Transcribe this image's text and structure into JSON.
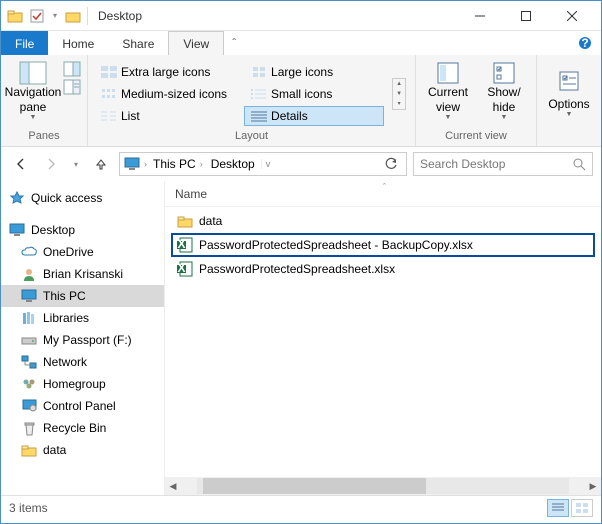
{
  "window": {
    "title": "Desktop"
  },
  "tabs": {
    "file": "File",
    "home": "Home",
    "share": "Share",
    "view": "View"
  },
  "ribbon": {
    "panes": {
      "label": "Panes",
      "nav_pane": "Navigation\npane"
    },
    "layout": {
      "label": "Layout",
      "items": [
        "Extra large icons",
        "Large icons",
        "Medium-sized icons",
        "Small icons",
        "List",
        "Details"
      ]
    },
    "current_view": {
      "label": "Current view",
      "current": "Current\nview",
      "showhide": "Show/\nhide"
    },
    "options": {
      "label": "",
      "options": "Options"
    }
  },
  "address": {
    "crumbs": [
      "This PC",
      "Desktop"
    ],
    "search_placeholder": "Search Desktop"
  },
  "nav": {
    "quick_access": "Quick access",
    "desktop": "Desktop",
    "items": [
      "OneDrive",
      "Brian Krisanski",
      "This PC",
      "Libraries",
      "My Passport (F:)",
      "Network",
      "Homegroup",
      "Control Panel",
      "Recycle Bin",
      "data"
    ]
  },
  "content": {
    "column": "Name",
    "files": [
      {
        "name": "data",
        "type": "folder"
      },
      {
        "name": "PasswordProtectedSpreadsheet - BackupCopy.xlsx",
        "type": "xlsx",
        "hl": true
      },
      {
        "name": "PasswordProtectedSpreadsheet.xlsx",
        "type": "xlsx"
      }
    ]
  },
  "status": {
    "items": "3 items"
  }
}
